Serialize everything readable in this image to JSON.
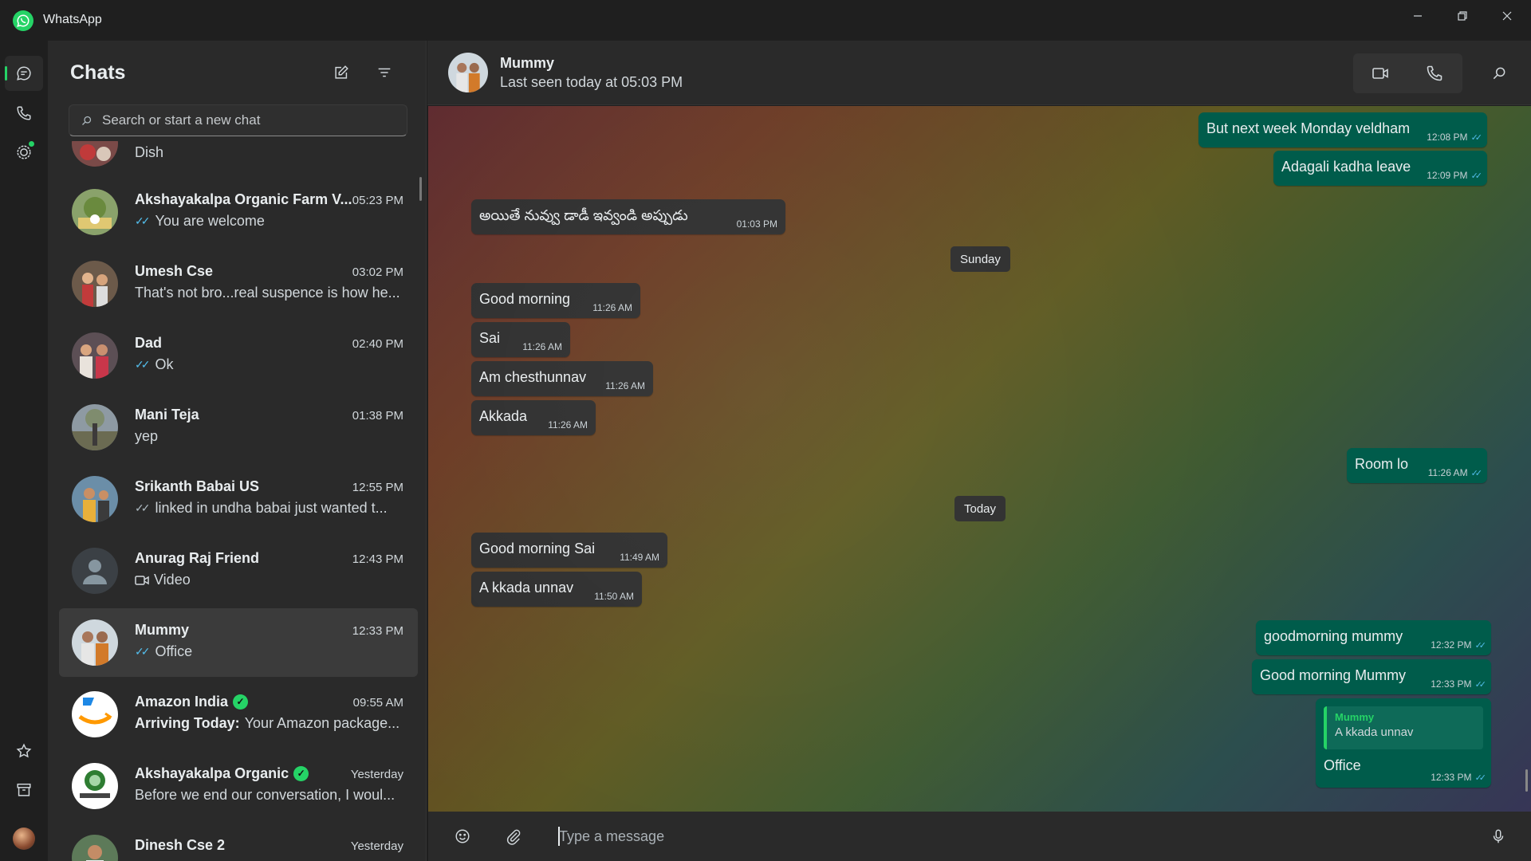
{
  "window": {
    "title": "WhatsApp"
  },
  "rail": {
    "chats": "chats-icon",
    "calls": "phone-icon",
    "status": "status-icon",
    "starred": "star-icon",
    "archived": "archive-icon",
    "settings": "gear-icon"
  },
  "chatlist": {
    "title": "Chats",
    "search_placeholder": "Search or start a new chat",
    "items": [
      {
        "name": "",
        "time": "",
        "preview": "Dish",
        "tick": ""
      },
      {
        "name": "Akshayakalpa Organic Farm V...",
        "time": "05:23 PM",
        "preview": "You are welcome",
        "tick": "blue"
      },
      {
        "name": "Umesh Cse",
        "time": "03:02 PM",
        "preview": "That's not bro...real suspence is how he...",
        "tick": ""
      },
      {
        "name": "Dad",
        "time": "02:40 PM",
        "preview": "Ok",
        "tick": "blue"
      },
      {
        "name": "Mani Teja",
        "time": "01:38 PM",
        "preview": "yep",
        "tick": ""
      },
      {
        "name": "Srikanth Babai US",
        "time": "12:55 PM",
        "preview": "linked in undha babai just wanted t...",
        "tick": "grey"
      },
      {
        "name": "Anurag Raj Friend",
        "time": "12:43 PM",
        "preview": "Video",
        "tick": ""
      },
      {
        "name": "Mummy",
        "time": "12:33 PM",
        "preview": "Office",
        "tick": "blue"
      },
      {
        "name": "Amazon India",
        "time": "09:55 AM",
        "preview_bold": "Arriving Today:",
        "preview": "Your Amazon package...",
        "tick": ""
      },
      {
        "name": "Akshayakalpa Organic",
        "time": "Yesterday",
        "preview": "Before we end our conversation, I woul...",
        "tick": ""
      },
      {
        "name": "Dinesh Cse 2",
        "time": "Yesterday",
        "preview": "",
        "tick": ""
      }
    ]
  },
  "conversation": {
    "name": "Mummy",
    "status": "Last seen today at 05:03 PM",
    "messages": [
      {
        "dir": "out",
        "text": "But next week Monday veldham",
        "time": "12:08 PM"
      },
      {
        "dir": "out",
        "text": "Adagali kadha leave",
        "time": "12:09 PM"
      },
      {
        "dir": "in",
        "text": "అయితే నువ్వు డాడీ ఇవ్వండి అప్పుడు",
        "time": "01:03 PM"
      },
      {
        "dir": "in",
        "text": "Good morning",
        "time": "11:26 AM"
      },
      {
        "dir": "in",
        "text": "Sai",
        "time": "11:26 AM"
      },
      {
        "dir": "in",
        "text": "Am chesthunnav",
        "time": "11:26 AM"
      },
      {
        "dir": "in",
        "text": "Akkada",
        "time": "11:26 AM"
      },
      {
        "dir": "out",
        "text": "Room lo",
        "time": "11:26 AM"
      },
      {
        "dir": "in",
        "text": "Good morning Sai",
        "time": "11:49 AM"
      },
      {
        "dir": "in",
        "text": "A kkada unnav",
        "time": "11:50 AM"
      },
      {
        "dir": "out",
        "text": "goodmorning mummy",
        "time": "12:32 PM"
      },
      {
        "dir": "out",
        "text": "Good morning Mummy",
        "time": "12:33 PM"
      },
      {
        "dir": "out",
        "text": "Office",
        "time": "12:33 PM",
        "reply_name": "Mummy",
        "reply_text": "A kkada unnav"
      }
    ],
    "date_sunday": "Sunday",
    "date_today": "Today"
  },
  "composer": {
    "placeholder": "Type a message"
  },
  "colors": {
    "accent": "#25d366",
    "outgoing": "#005c4b",
    "incoming": "#2e2e2e",
    "tick": "#53bdeb"
  }
}
